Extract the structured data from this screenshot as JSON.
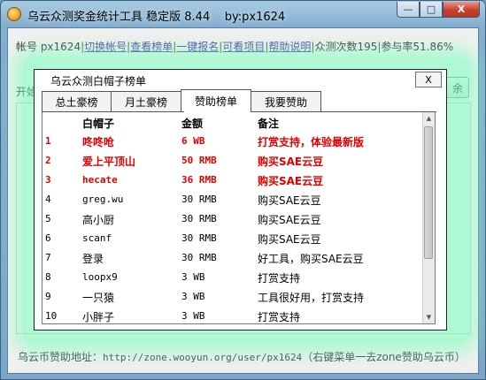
{
  "window": {
    "title": "乌云众测奖金统计工具 稳定版 8.44    by:px1624",
    "min_symbol": "—",
    "max_symbol": "□",
    "close_symbol": "X"
  },
  "top_bar": {
    "account_label": "帐号 px1624",
    "links": [
      "切换帐号",
      "查看榜单",
      "一键报名",
      "可看项目",
      "帮助说明"
    ],
    "stats": [
      "众测次数195",
      "参与率51.86%"
    ]
  },
  "background": {
    "start_label": "开始",
    "right_button_label": "余"
  },
  "bottom_bar": {
    "label": "乌云币赞助地址：",
    "url": "http://zone.wooyun.org/user/px1624",
    "hint": "（右键菜单一去zone赞助乌云币）"
  },
  "dialog": {
    "title": "乌云众测白帽子榜单",
    "close_label": "X",
    "tabs": [
      {
        "label": "总土豪榜",
        "active": false
      },
      {
        "label": "月土豪榜",
        "active": false
      },
      {
        "label": "赞助榜单",
        "active": true
      },
      {
        "label": "我要赞助",
        "active": false
      }
    ],
    "columns": {
      "name": "白帽子",
      "amount": "金额",
      "note": "备注"
    },
    "rows": [
      {
        "rank": "1",
        "name": "咚咚呛",
        "amount": "6 WB",
        "note": "打赏支持，体验最新版",
        "highlight": true
      },
      {
        "rank": "2",
        "name": "爱上平顶山",
        "amount": "50 RMB",
        "note": "购买SAE云豆",
        "highlight": true
      },
      {
        "rank": "3",
        "name": "hecate",
        "amount": "36 RMB",
        "note": "购买SAE云豆",
        "highlight": true
      },
      {
        "rank": "4",
        "name": "greg.wu",
        "amount": "30 RMB",
        "note": "购买SAE云豆",
        "highlight": false
      },
      {
        "rank": "5",
        "name": "高小厨",
        "amount": "30 RMB",
        "note": "购买SAE云豆",
        "highlight": false
      },
      {
        "rank": "6",
        "name": "scanf",
        "amount": "30 RMB",
        "note": "购买SAE云豆",
        "highlight": false
      },
      {
        "rank": "7",
        "name": "登录",
        "amount": "30 RMB",
        "note": "好工具，购买SAE云豆",
        "highlight": false
      },
      {
        "rank": "8",
        "name": "loopx9",
        "amount": "3 WB",
        "note": "打赏支持",
        "highlight": false
      },
      {
        "rank": "9",
        "name": "一只猿",
        "amount": "3 WB",
        "note": "工具很好用，打赏支持",
        "highlight": false
      },
      {
        "rank": "10",
        "name": "小胖子",
        "amount": "3 WB",
        "note": "打赏支持",
        "highlight": false
      }
    ]
  },
  "colors": {
    "highlight_text": "#e00000",
    "glow": "#78ffbe",
    "link": "#5a3aa0"
  }
}
